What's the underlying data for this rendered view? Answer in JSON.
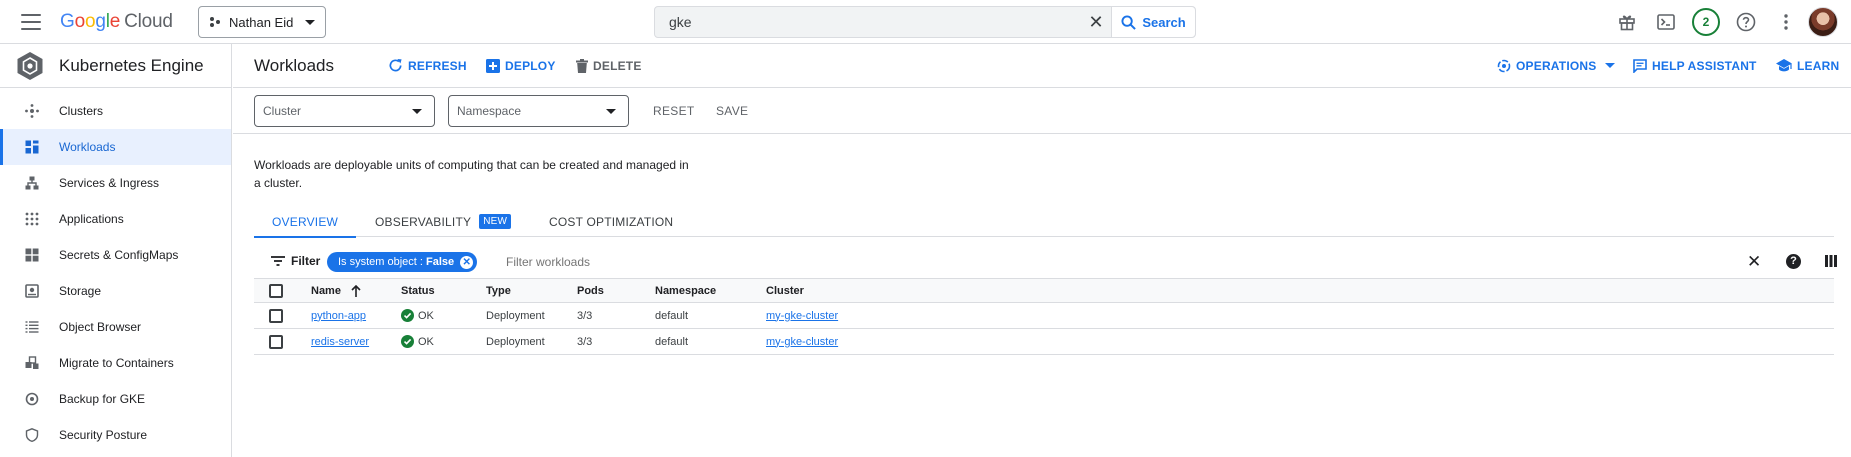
{
  "topbar": {
    "logo_parts": [
      "G",
      "o",
      "o",
      "g",
      "l",
      "e"
    ],
    "logo_product": "Cloud",
    "project_name": "Nathan Eid",
    "search_value": "gke",
    "search_button": "Search",
    "notification_count": "2"
  },
  "sidebar": {
    "product_title": "Kubernetes Engine",
    "items": [
      {
        "label": "Clusters",
        "icon": "clusters-icon"
      },
      {
        "label": "Workloads",
        "icon": "workloads-icon",
        "active": true
      },
      {
        "label": "Services & Ingress",
        "icon": "services-icon"
      },
      {
        "label": "Applications",
        "icon": "applications-icon"
      },
      {
        "label": "Secrets & ConfigMaps",
        "icon": "secrets-icon"
      },
      {
        "label": "Storage",
        "icon": "storage-icon"
      },
      {
        "label": "Object Browser",
        "icon": "object-browser-icon"
      },
      {
        "label": "Migrate to Containers",
        "icon": "migrate-icon"
      },
      {
        "label": "Backup for GKE",
        "icon": "backup-icon"
      },
      {
        "label": "Security Posture",
        "icon": "security-icon"
      }
    ]
  },
  "header": {
    "title": "Workloads",
    "refresh": "REFRESH",
    "deploy": "DEPLOY",
    "delete": "DELETE",
    "operations": "OPERATIONS",
    "help_assistant": "HELP ASSISTANT",
    "learn": "LEARN"
  },
  "filters": {
    "cluster_placeholder": "Cluster",
    "namespace_placeholder": "Namespace",
    "reset": "RESET",
    "save": "SAVE"
  },
  "description": "Workloads are deployable units of computing that can be created and managed in a cluster.",
  "tabs": {
    "overview": "OVERVIEW",
    "observability": "OBSERVABILITY",
    "observability_badge": "NEW",
    "cost_optimization": "COST OPTIMIZATION"
  },
  "filterbar": {
    "filter_label": "Filter",
    "chip_key": "Is system object",
    "chip_value": "False",
    "input_placeholder": "Filter workloads"
  },
  "table": {
    "columns": {
      "name": "Name",
      "status": "Status",
      "type": "Type",
      "pods": "Pods",
      "namespace": "Namespace",
      "cluster": "Cluster"
    },
    "rows": [
      {
        "name": "python-app",
        "status": "OK",
        "type": "Deployment",
        "pods": "3/3",
        "namespace": "default",
        "cluster": "my-gke-cluster"
      },
      {
        "name": "redis-server",
        "status": "OK",
        "type": "Deployment",
        "pods": "3/3",
        "namespace": "default",
        "cluster": "my-gke-cluster"
      }
    ]
  },
  "colors": {
    "accent": "#1a73e8",
    "ok": "#188038",
    "active_bg": "#e8f0fe",
    "border": "#dadce0"
  }
}
